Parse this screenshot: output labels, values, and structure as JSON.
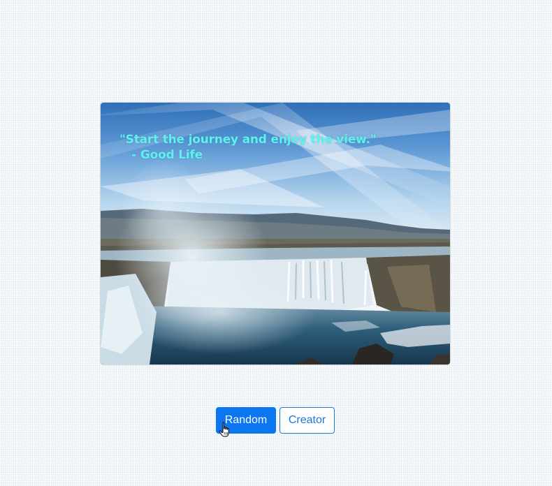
{
  "quote": {
    "text": "\"Start the journey and enjoy the view.\"",
    "dash": "-",
    "author": "Good Life",
    "text_color": "#5ff0ec"
  },
  "image": {
    "subject": "waterfall landscape under blue sky"
  },
  "buttons": {
    "random_label": "Random",
    "creator_label": "Creator",
    "primary_color": "#0b76f0"
  },
  "cursor": {
    "type": "hand-pointer-icon"
  }
}
